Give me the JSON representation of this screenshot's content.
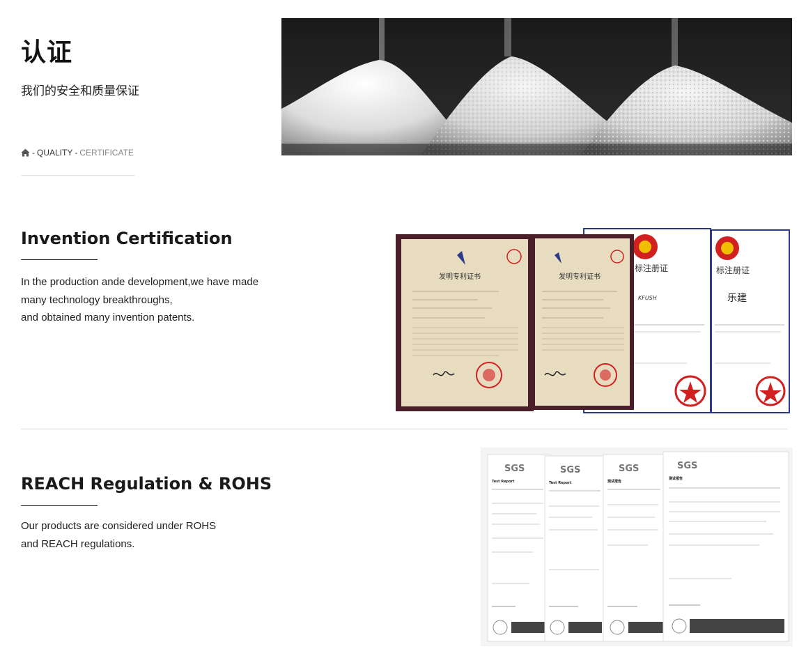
{
  "header": {
    "title": "认证",
    "subtitle": "我们的安全和质量保证"
  },
  "breadcrumb": {
    "home_icon": "home-icon",
    "separator": "-",
    "items": [
      {
        "label": "QUALITY"
      },
      {
        "label": "CERTIFICATE"
      }
    ]
  },
  "sections": [
    {
      "title": "Invention Certification",
      "lines": [
        "In the production ande development,we have made",
        "many technology breakthroughs,",
        "and obtained many invention patents."
      ]
    },
    {
      "title": "REACH Regulation & ROHS",
      "lines": [
        "Our products are considered under ROHS",
        "and REACH regulations."
      ]
    }
  ],
  "certificates": {
    "patent_title": "发明专利证书",
    "trademark_title": "标注册证",
    "trademark_name_2": "乐建",
    "trademark_name_1": "KFUSH",
    "sgs_logo": "SGS",
    "report_title": "Test Report",
    "report_title_cn": "测试报告"
  },
  "colors": {
    "frame": "#4a1f2a",
    "paper": "#e8dcc0",
    "seal_red": "#d22020",
    "trademark_border": "#2b3a8c"
  }
}
